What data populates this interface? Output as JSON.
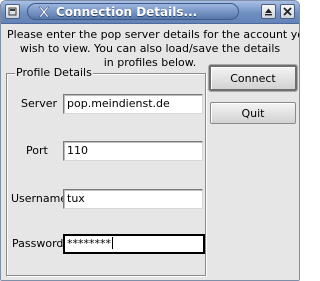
{
  "window": {
    "title": "Connection Details..."
  },
  "message": {
    "line1": "Please enter the pop server details for the account you",
    "line2": "wish to view. You can also load/save the details",
    "line3": "in profiles below."
  },
  "profile": {
    "group_title": "Profile Details",
    "server_label": "Server",
    "server_value": "pop.meindienst.de",
    "port_label": "Port",
    "port_value": "110",
    "username_label": "Username",
    "username_value": "tux",
    "password_label": "Password",
    "password_value": "********"
  },
  "buttons": {
    "connect": "Connect",
    "quit": "Quit"
  },
  "icons": {
    "window_menu": "window-menu-icon",
    "app": "x-logo-icon",
    "shade": "shade-icon",
    "close": "close-icon"
  },
  "colors": {
    "titlebar": "#6f8fbf",
    "dialog_bg": "#e6e6e6"
  }
}
